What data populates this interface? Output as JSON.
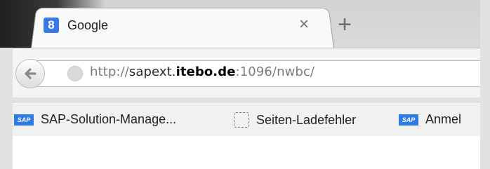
{
  "tab": {
    "title": "Google",
    "favicon_letter": "8",
    "close_symbol": "×"
  },
  "newtab": {
    "symbol": "+"
  },
  "nav": {
    "back_symbol": "←"
  },
  "address": {
    "scheme": "http://",
    "subdomain": "sapext.",
    "domain": "itebo.de",
    "rest": ":1096/nwbc/"
  },
  "bookmarks": {
    "items": [
      {
        "label": "SAP-Solution-Manage...",
        "icon": "sap-logo-icon"
      },
      {
        "label": "Seiten-Ladefehler",
        "icon": "dashed-page-icon"
      },
      {
        "label": "Anmel",
        "icon": "sap-logo-icon"
      }
    ],
    "sap_logo_text": "SAP"
  },
  "colors": {
    "favicon_bg": "#3b78e7",
    "sap_blue": "#2f7be6"
  }
}
